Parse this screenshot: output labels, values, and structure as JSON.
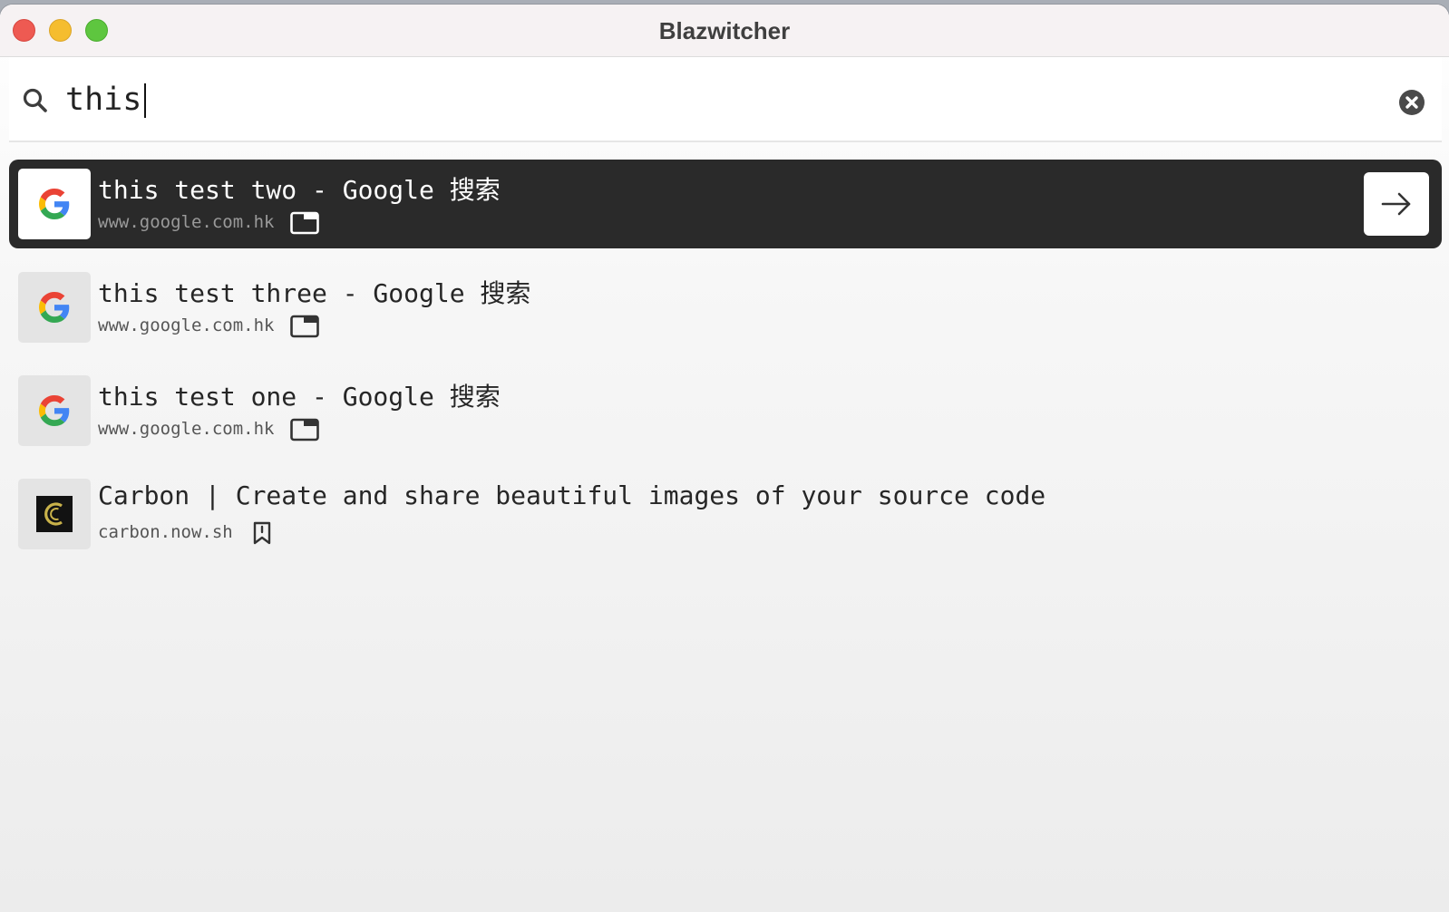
{
  "window": {
    "title": "Blazwitcher"
  },
  "search": {
    "value": "this",
    "placeholder": ""
  },
  "results": [
    {
      "title": "this test two - Google 搜索",
      "url": "www.google.com.hk",
      "favicon": "google-icon",
      "kind": "tab-icon",
      "selected": true
    },
    {
      "title": "this test three - Google 搜索",
      "url": "www.google.com.hk",
      "favicon": "google-icon",
      "kind": "tab-icon",
      "selected": false
    },
    {
      "title": "this test one - Google 搜索",
      "url": "www.google.com.hk",
      "favicon": "google-icon",
      "kind": "tab-icon",
      "selected": false
    },
    {
      "title": "Carbon | Create and share beautiful images of your source code",
      "url": "carbon.now.sh",
      "favicon": "carbon-icon",
      "kind": "bookmark-icon",
      "selected": false
    }
  ],
  "colors": {
    "selected_row": "#2a2a2a",
    "close": "#ee5a52",
    "minimize": "#f5bd2f",
    "maximize": "#5ec63f"
  }
}
